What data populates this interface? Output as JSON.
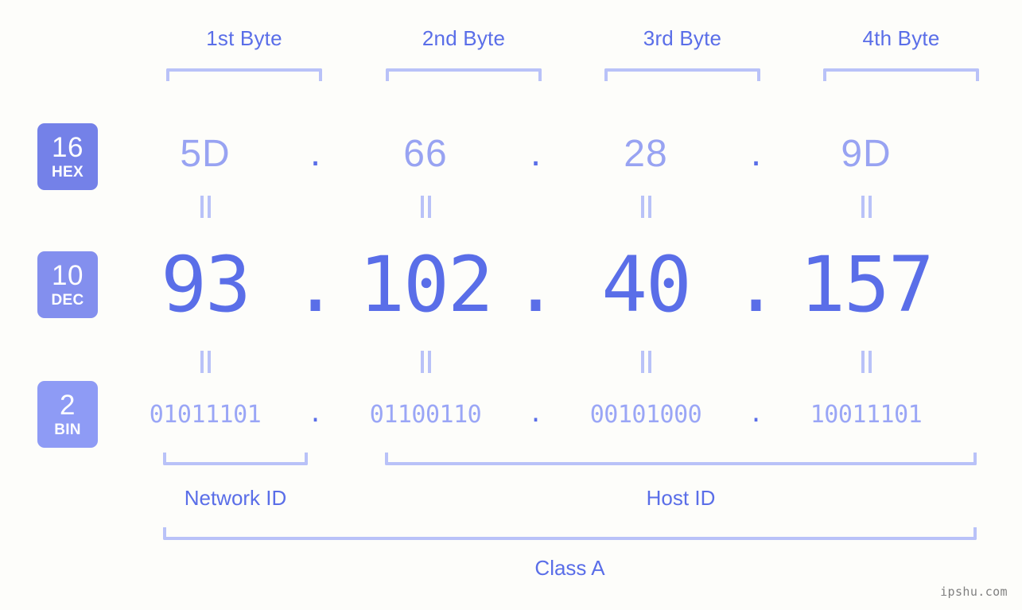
{
  "background_color": "#fdfdfa",
  "accent_color": "#5a6ee8",
  "bracket_color": "#b9c2f8",
  "byte_headers": [
    {
      "label": "1st Byte"
    },
    {
      "label": "2nd Byte"
    },
    {
      "label": "3rd Byte"
    },
    {
      "label": "4th Byte"
    }
  ],
  "bases": {
    "hex": {
      "number": "16",
      "name": "HEX",
      "color": "#7481e8"
    },
    "dec": {
      "number": "10",
      "name": "DEC",
      "color": "#838fee"
    },
    "bin": {
      "number": "2",
      "name": "BIN",
      "color": "#8e9bf5"
    }
  },
  "separator": ".",
  "rows": {
    "hex": {
      "octets": [
        "5D",
        "66",
        "28",
        "9D"
      ]
    },
    "dec": {
      "octets": [
        "93",
        "102",
        "40",
        "157"
      ]
    },
    "bin": {
      "octets": [
        "01011101",
        "01100110",
        "00101000",
        "10011101"
      ]
    }
  },
  "equality_marker": "=",
  "sections": {
    "network_id": "Network ID",
    "host_id": "Host ID",
    "class": "Class A"
  },
  "watermark": "ipshu.com"
}
